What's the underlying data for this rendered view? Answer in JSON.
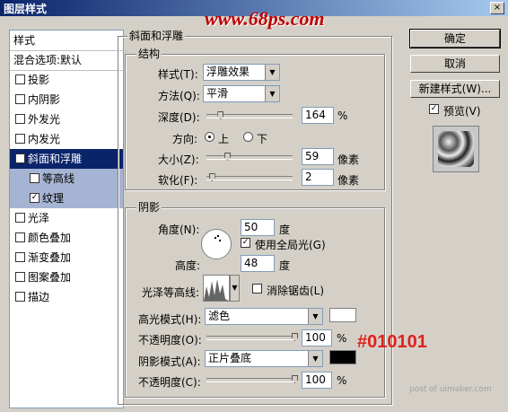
{
  "window": {
    "title": "图层样式",
    "close_glyph": "×"
  },
  "watermark": "www.68ps.com",
  "styles_panel": {
    "header": "样式",
    "blend_item": "混合选项:默认",
    "items": [
      {
        "label": "投影",
        "checked": false
      },
      {
        "label": "内阴影",
        "checked": false
      },
      {
        "label": "外发光",
        "checked": false
      },
      {
        "label": "内发光",
        "checked": false
      },
      {
        "label": "斜面和浮雕",
        "checked": true
      },
      {
        "label": "等高线",
        "checked": false
      },
      {
        "label": "纹理",
        "checked": true
      },
      {
        "label": "光泽",
        "checked": false
      },
      {
        "label": "颜色叠加",
        "checked": false
      },
      {
        "label": "渐变叠加",
        "checked": false
      },
      {
        "label": "图案叠加",
        "checked": false
      },
      {
        "label": "描边",
        "checked": false
      }
    ]
  },
  "bevel": {
    "group_title": "斜面和浮雕",
    "structure_title": "结构",
    "style_label": "样式(T):",
    "style_value": "浮雕效果",
    "technique_label": "方法(Q):",
    "technique_value": "平滑",
    "depth_label": "深度(D):",
    "depth_value": "164",
    "depth_unit": "%",
    "depth_slider": 0.16,
    "direction_label": "方向:",
    "dir_up": "上",
    "dir_down": "下",
    "size_label": "大小(Z):",
    "size_value": "59",
    "size_unit": "像素",
    "size_slider": 0.24,
    "soften_label": "软化(F):",
    "soften_value": "2",
    "soften_unit": "像素",
    "soften_slider": 0.06
  },
  "shading": {
    "title": "阴影",
    "angle_label": "角度(N):",
    "angle_value": "50",
    "angle_unit": "度",
    "global_light": "使用全局光(G)",
    "global_light_checked": true,
    "altitude_label": "高度:",
    "altitude_value": "48",
    "altitude_unit": "度",
    "gloss_label": "光泽等高线:",
    "antialias": "消除锯齿(L)",
    "antialias_checked": false,
    "highlight_label": "高光模式(H):",
    "highlight_mode": "滤色",
    "highlight_color": "#ffffff",
    "hl_opacity_label": "不透明度(O):",
    "hl_opacity_value": "100",
    "hl_opacity_unit": "%",
    "shadow_label": "阴影模式(A):",
    "shadow_mode": "正片叠底",
    "shadow_color": "#010101",
    "sh_opacity_label": "不透明度(C):",
    "sh_opacity_value": "100",
    "sh_opacity_unit": "%"
  },
  "buttons": {
    "ok": "确定",
    "cancel": "取消",
    "new_style": "新建样式(W)...",
    "preview": "预览(V)",
    "preview_checked": true
  },
  "annotation": "#010101",
  "footer_watermark": "post of uimaker.com",
  "colors": {
    "titlebar": "#0a246a",
    "selection": "#0a246a",
    "annotation": "#e0201c"
  }
}
